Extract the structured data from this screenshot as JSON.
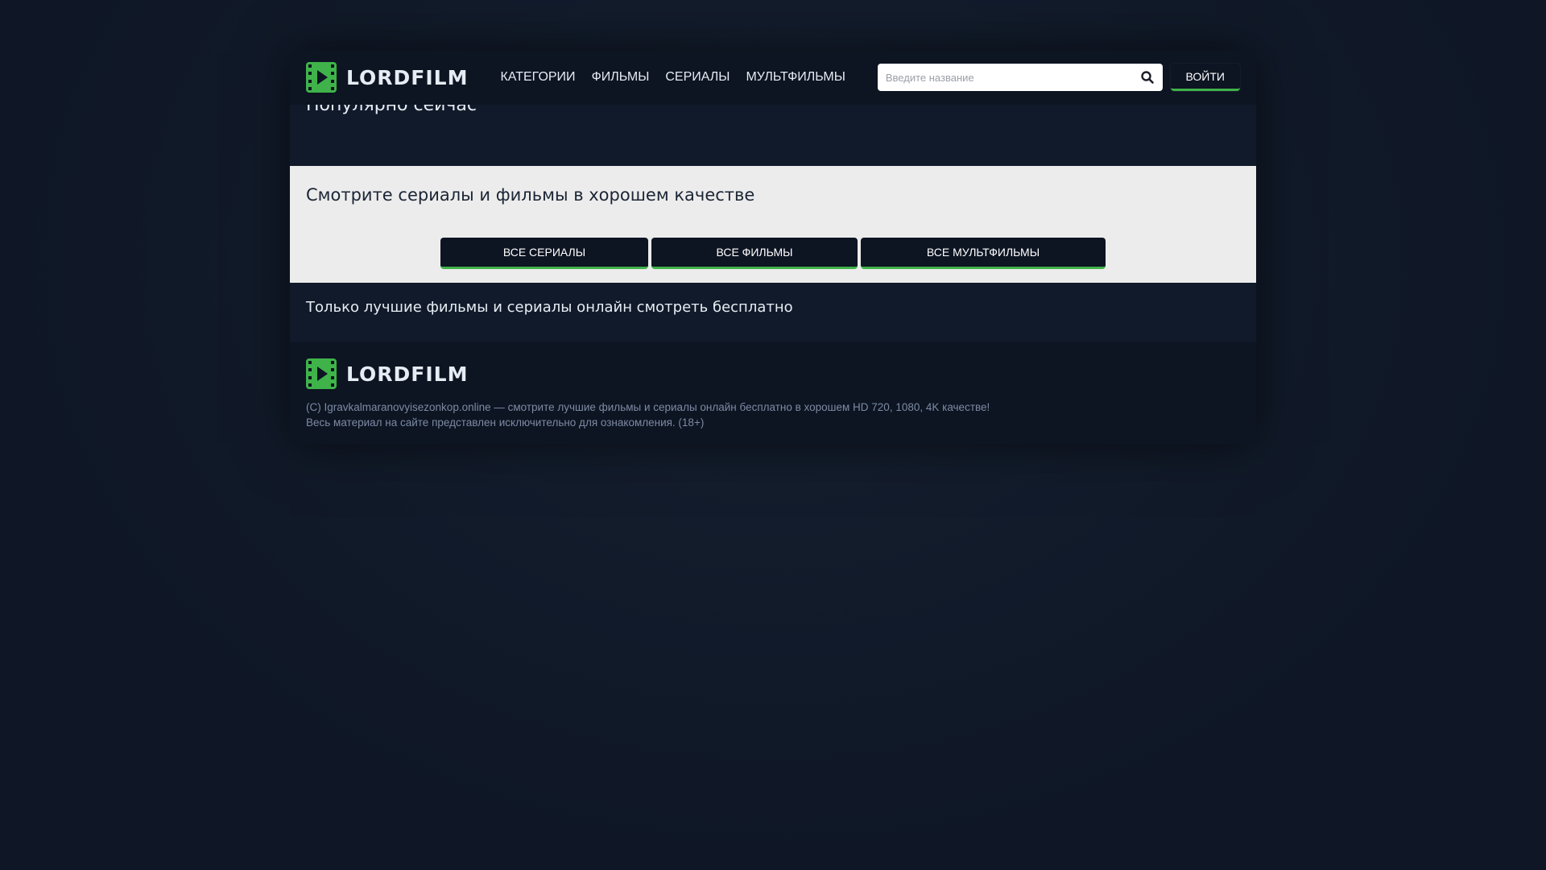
{
  "header": {
    "logo_text": "LORDFILM",
    "nav": [
      "КАТЕГОРИИ",
      "ФИЛЬМЫ",
      "СЕРИАЛЫ",
      "МУЛЬТФИЛЬМЫ"
    ],
    "search_placeholder": "Введите название",
    "search_value": "",
    "login_label": "ВОЙТИ"
  },
  "popular": {
    "title": "Популярно сейчас"
  },
  "promo": {
    "title": "Смотрите сериалы и фильмы в хорошем качестве",
    "buttons": [
      "ВСЕ СЕРИАЛЫ",
      "ВСЕ ФИЛЬМЫ",
      "ВСЕ МУЛЬТФИЛЬМЫ"
    ]
  },
  "tagline": {
    "text": "Только лучшие фильмы и сериалы онлайн смотреть бесплатно"
  },
  "footer": {
    "logo_text": "LORDFILM",
    "copyright": "(C) Igravkalmaranovyisezonkop.online — смотрите лучшие фильмы и сериалы онлайн бесплатно в хорошем HD 720, 1080, 4K качестве!",
    "disclaimer": "Весь материал на сайте представлен исключительно для ознакомления. (18+)"
  },
  "colors": {
    "background": "#0f1726",
    "panel": "#0d1422",
    "section": "#111a2a",
    "promo_bg": "#ececec",
    "accent": "#3fb34a",
    "text_light": "#e6ecf3",
    "footer_text": "#7c8ba3"
  },
  "icons": {
    "logo": "film-play-icon",
    "search": "search-icon"
  }
}
